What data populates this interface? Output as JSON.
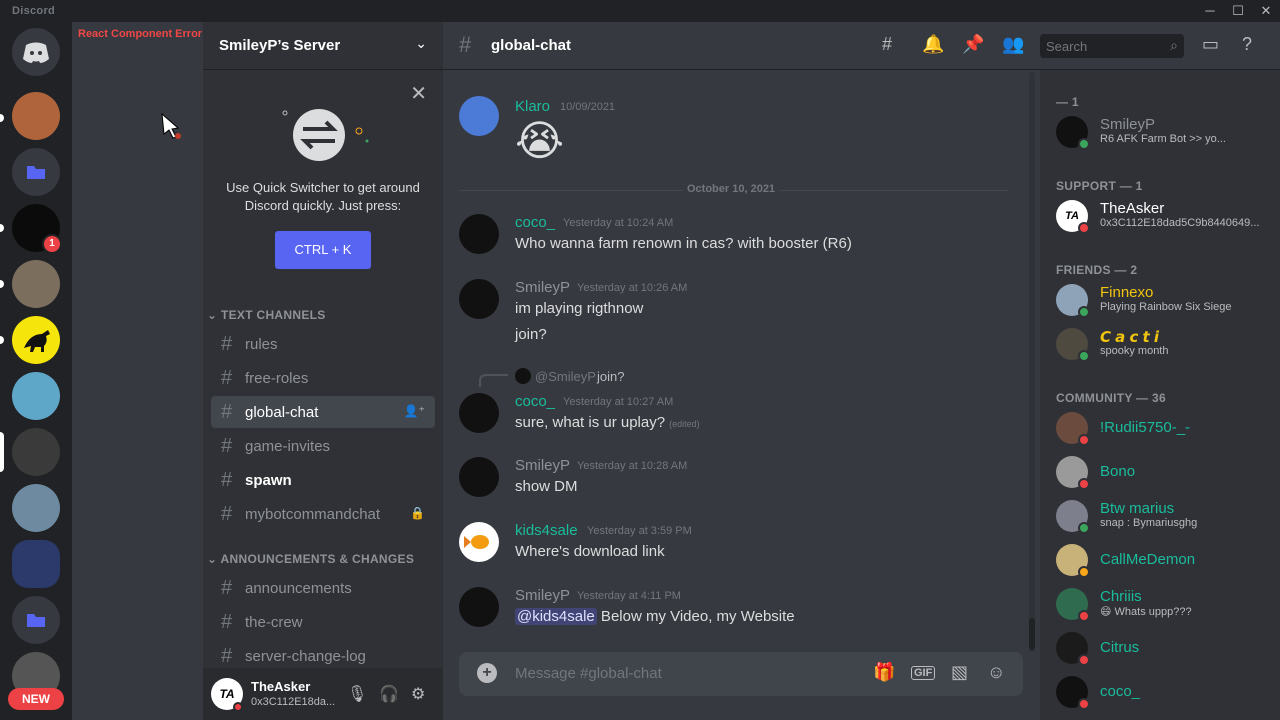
{
  "titlebar": {
    "brand": "Discord",
    "minimize": "─",
    "maximize": "☐",
    "close": "✕"
  },
  "rail": {
    "new_badge": "NEW",
    "mention_count": "1"
  },
  "error": {
    "text": "React Component Error"
  },
  "server": {
    "name": "SmileyP’s Server"
  },
  "quick_switcher": {
    "text": "Use Quick Switcher to get around Discord quickly. Just press:",
    "shortcut": "CTRL + K"
  },
  "categories": {
    "text_channels": "TEXT CHANNELS",
    "announcements": "ANNOUNCEMENTS & CHANGES"
  },
  "channels": [
    {
      "name": "rules"
    },
    {
      "name": "free-roles"
    },
    {
      "name": "global-chat"
    },
    {
      "name": "game-invites"
    },
    {
      "name": "spawn"
    },
    {
      "name": "mybotcommandchat"
    },
    {
      "name": "announcements"
    },
    {
      "name": "the-crew"
    },
    {
      "name": "server-change-log"
    }
  ],
  "user": {
    "name": "TheAsker",
    "tag": "0x3C112E18da...",
    "initials": "TA"
  },
  "chat": {
    "channel": "global-chat",
    "search_placeholder": "Search",
    "composer_placeholder": "Message #global-chat",
    "date_divider": "October 10, 2021"
  },
  "messages": [
    {
      "author": "Klaro",
      "color": "#1abc9c",
      "timestamp": "10/09/2021",
      "text": "😭"
    },
    {
      "author": "coco_",
      "color": "#1abc9c",
      "timestamp": "Yesterday at 10:24 AM",
      "text": "Who wanna farm renown in cas? with booster (R6)"
    },
    {
      "author": "SmileyP",
      "color": "#8e9297",
      "timestamp": "Yesterday at 10:26 AM",
      "text": "im playing rigthnow",
      "text2": "join?"
    },
    {
      "reply_author": "@SmileyP",
      "reply_text": "join?",
      "author": "coco_",
      "color": "#1abc9c",
      "timestamp": "Yesterday at 10:27 AM",
      "text": "sure, what is ur uplay?",
      "edited": "(edited)"
    },
    {
      "author": "SmileyP",
      "color": "#8e9297",
      "timestamp": "Yesterday at 10:28 AM",
      "text": "show DM"
    },
    {
      "author": "kids4sale",
      "color": "#1abc9c",
      "timestamp": "Yesterday at 3:59 PM",
      "text": "Where's download link"
    },
    {
      "author": "SmileyP",
      "color": "#8e9297",
      "timestamp": "Yesterday at 4:11 PM",
      "mention": "@kids4sale",
      "text": " Below my Video, my Website"
    }
  ],
  "members": {
    "cat_top": "— 1",
    "cat_support": "SUPPORT — 1",
    "cat_friends": "FRIENDS — 2",
    "cat_community": "COMMUNITY — 36",
    "list": [
      {
        "name": "SmileyP",
        "sub": "R6 AFK Farm Bot >> yo...",
        "color": "#8e9297",
        "status": "#3ba55c"
      },
      {
        "name": "TheAsker",
        "sub": "0x3C112E18dad5C9b8440649...",
        "color": "#ffffff",
        "status": "#ed4245"
      },
      {
        "name": "Finnexo",
        "sub": "Playing Rainbow Six Siege",
        "color": "#f1c40f",
        "status": "#3ba55c"
      },
      {
        "name": "𝘾 𝙖 𝙘 𝙩 𝙞",
        "sub": "spooky month",
        "color": "#f1c40f",
        "status": "#3ba55c"
      },
      {
        "name": "!Rudii5750-_-",
        "sub": "",
        "color": "#1abc9c",
        "status": "#ed4245"
      },
      {
        "name": "Bono",
        "sub": "",
        "color": "#1abc9c",
        "status": "#ed4245"
      },
      {
        "name": "Btw marius",
        "sub": "snap : Bymariusghg",
        "color": "#1abc9c",
        "status": "#3ba55c"
      },
      {
        "name": "CallMeDemon",
        "sub": "",
        "color": "#1abc9c",
        "status": "#faa61a"
      },
      {
        "name": "Chriiis",
        "sub": "😄 Whats uppp???",
        "color": "#1abc9c",
        "status": "#ed4245"
      },
      {
        "name": "Citrus",
        "sub": "",
        "color": "#1abc9c",
        "status": "#ed4245"
      },
      {
        "name": "coco_",
        "sub": "",
        "color": "#1abc9c",
        "status": "#ed4245"
      }
    ]
  }
}
